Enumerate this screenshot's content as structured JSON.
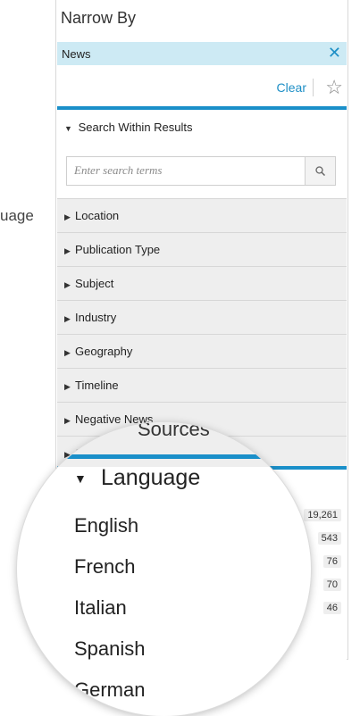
{
  "stray_label": "uage",
  "panel": {
    "title": "Narrow By",
    "active_filter": {
      "label": "News",
      "close_glyph": "✕"
    },
    "clear_label": "Clear",
    "search_within": {
      "heading": "Search Within Results",
      "placeholder": "Enter search terms"
    },
    "facets": [
      {
        "label": "Location"
      },
      {
        "label": "Publication Type"
      },
      {
        "label": "Subject"
      },
      {
        "label": "Industry"
      },
      {
        "label": "Geography"
      },
      {
        "label": "Timeline"
      },
      {
        "label": "Negative News"
      },
      {
        "label": "Sources"
      }
    ]
  },
  "language": {
    "heading": "Language",
    "options": [
      {
        "label": "English",
        "count": "19,261"
      },
      {
        "label": "French",
        "count": "543"
      },
      {
        "label": "Italian",
        "count": "76"
      },
      {
        "label": "Spanish",
        "count": "70"
      },
      {
        "label": "German",
        "count": "46"
      }
    ]
  },
  "colors": {
    "accent": "#1a8fc9",
    "filter_bg": "#cdeaf4",
    "facet_bg": "#eeeeee"
  }
}
